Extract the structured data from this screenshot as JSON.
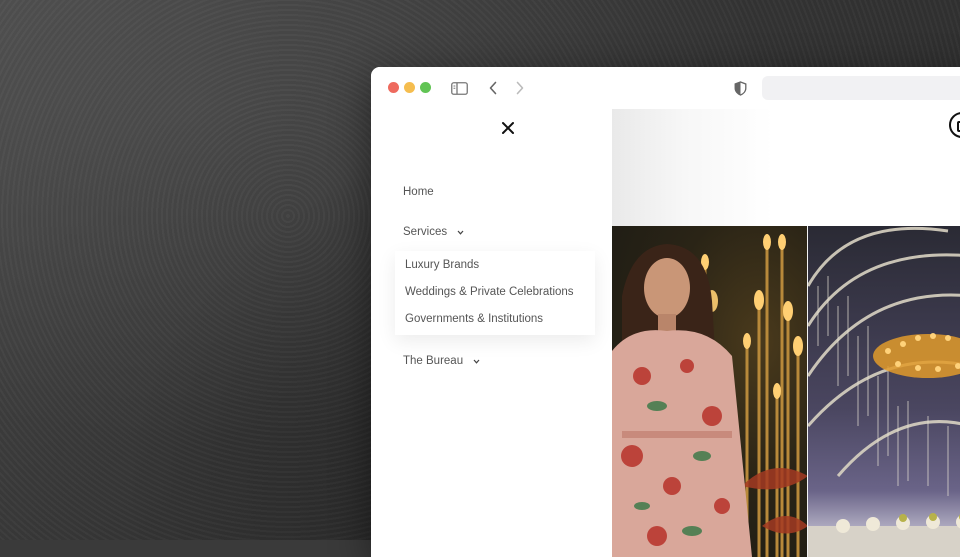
{
  "browser": {
    "controls": {
      "close_color": "#ee6a5e",
      "minimize_color": "#f5bd4f",
      "zoom_color": "#61c454"
    },
    "icons": [
      "sidebar-toggle-icon",
      "chevron-left-icon",
      "chevron-right-icon",
      "shield-icon"
    ],
    "address": ""
  },
  "menu": {
    "close_icon": "close-icon",
    "items": [
      {
        "label": "Home"
      },
      {
        "label": "Services",
        "expanded": true,
        "children": [
          {
            "label": "Luxury Brands"
          },
          {
            "label": "Weddings & Private Celebrations"
          },
          {
            "label": "Governments & Institutions"
          }
        ]
      },
      {
        "label": "The Bureau",
        "expanded": false
      }
    ]
  },
  "content": {
    "logo_icon": "logo-icon",
    "images": [
      "fashion-photo",
      "event-venue-photo"
    ]
  }
}
